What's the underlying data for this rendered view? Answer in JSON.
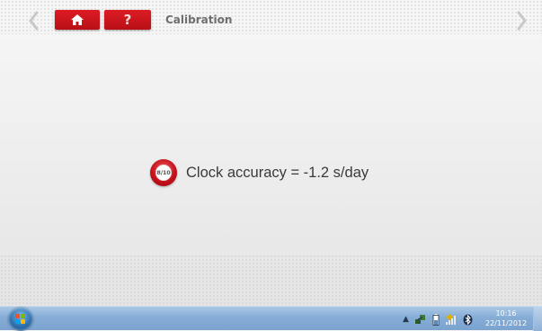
{
  "header": {
    "title": "Calibration",
    "help_label": "?",
    "icons": {
      "back": "chevron-left-icon",
      "forward": "chevron-right-icon",
      "home": "home-icon"
    }
  },
  "main": {
    "step": "8/10",
    "message": "Clock accuracy = -1.2 s/day"
  },
  "taskbar": {
    "start_icon": "windows-start-icon",
    "tray_icons": [
      "show-hidden-icons-arrow",
      "network-icon",
      "battery-icon",
      "signal-icon",
      "bluetooth-icon"
    ],
    "time": "10:16",
    "date": "22/11/2012"
  },
  "colors": {
    "accent_red": "#c7111a",
    "title_gray": "#6e6e6e",
    "text_dark": "#3a3a3a",
    "taskbar_blue": "#86add6"
  }
}
